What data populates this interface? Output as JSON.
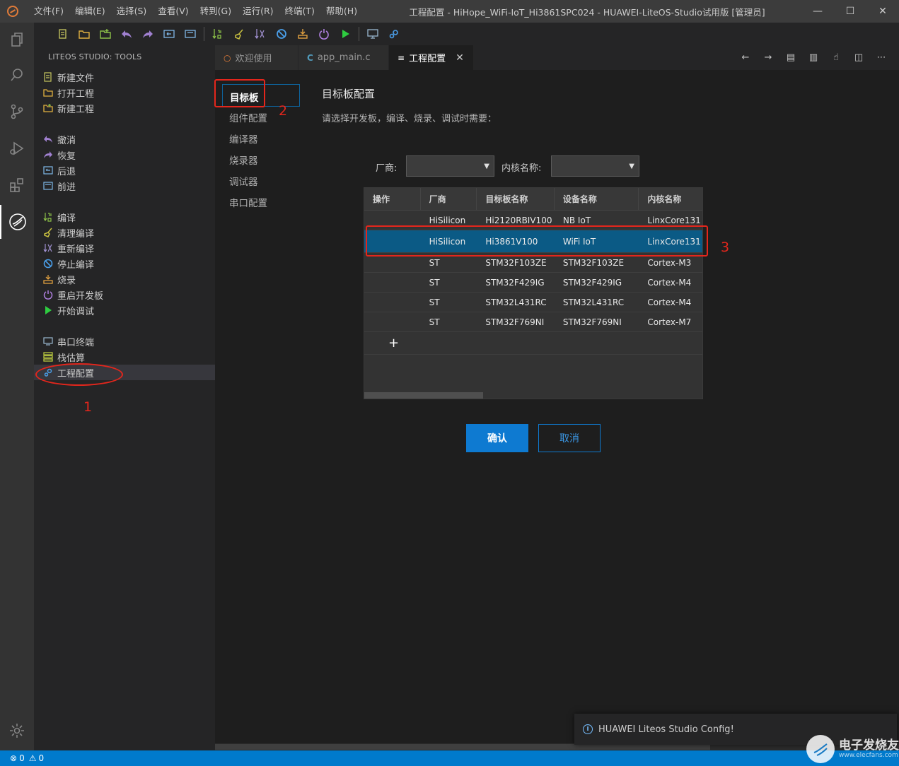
{
  "menu": [
    "文件(F)",
    "编辑(E)",
    "选择(S)",
    "查看(V)",
    "转到(G)",
    "运行(R)",
    "终端(T)",
    "帮助(H)"
  ],
  "window_title": "工程配置 - HiHope_WiFi-IoT_Hi3861SPC024 - HUAWEI-LiteOS-Studio试用版 [管理员]",
  "window_controls": {
    "minimize": "—",
    "maximize": "☐",
    "close": "✕"
  },
  "activity": [
    "files-icon",
    "search-icon",
    "source-control-icon",
    "run-debug-icon",
    "extensions-icon",
    "liteos-icon"
  ],
  "sidebar": {
    "header": "LITEOS STUDIO: TOOLS",
    "groups": [
      [
        {
          "label": "新建文件",
          "icon": "new-file-icon"
        },
        {
          "label": "打开工程",
          "icon": "open-project-icon"
        },
        {
          "label": "新建工程",
          "icon": "new-project-icon"
        }
      ],
      [
        {
          "label": "撤消",
          "icon": "undo-icon"
        },
        {
          "label": "恢复",
          "icon": "redo-icon"
        },
        {
          "label": "后退",
          "icon": "back-icon"
        },
        {
          "label": "前进",
          "icon": "forward-icon"
        }
      ],
      [
        {
          "label": "编译",
          "icon": "compile-icon"
        },
        {
          "label": "清理编译",
          "icon": "clean-icon"
        },
        {
          "label": "重新编译",
          "icon": "rebuild-icon"
        },
        {
          "label": "停止编译",
          "icon": "stop-icon"
        },
        {
          "label": "烧录",
          "icon": "burn-icon"
        },
        {
          "label": "重启开发板",
          "icon": "power-icon"
        },
        {
          "label": "开始调试",
          "icon": "play-icon"
        }
      ],
      [
        {
          "label": "串口终端",
          "icon": "serial-terminal-icon"
        },
        {
          "label": "栈估算",
          "icon": "stack-icon"
        },
        {
          "label": "工程配置",
          "icon": "config-icon"
        }
      ]
    ]
  },
  "tabs": [
    {
      "label": "欢迎使用",
      "icon": "○"
    },
    {
      "label": "app_main.c",
      "icon": "C"
    },
    {
      "label": "工程配置",
      "icon": "≡",
      "close": "✕"
    }
  ],
  "tab_actions": [
    "←",
    "→",
    "▤",
    "▥",
    "☝",
    "◫",
    "⋯"
  ],
  "config_nav": [
    "目标板",
    "组件配置",
    "编译器",
    "烧录器",
    "调试器",
    "串口配置"
  ],
  "config": {
    "title": "目标板配置",
    "desc": "请选择开发板，编译、烧录、调试时需要：",
    "vendor_label": "厂商:",
    "core_label": "内核名称:",
    "vendor_value": "",
    "core_value": "",
    "arrow": "▼"
  },
  "table": {
    "headers": [
      "操作",
      "厂商",
      "目标板名称",
      "设备名称",
      "内核名称"
    ],
    "rows": [
      [
        "",
        "HiSilicon",
        "Hi2120RBIV100",
        "NB IoT",
        "LinxCore131"
      ],
      [
        "",
        "HiSilicon",
        "Hi3861V100",
        "WiFi IoT",
        "LinxCore131"
      ],
      [
        "",
        "ST",
        "STM32F103ZE",
        "STM32F103ZE",
        "Cortex-M3"
      ],
      [
        "",
        "ST",
        "STM32F429IG",
        "STM32F429IG",
        "Cortex-M4"
      ],
      [
        "",
        "ST",
        "STM32L431RC",
        "STM32L431RC",
        "Cortex-M4"
      ],
      [
        "",
        "ST",
        "STM32F769NI",
        "STM32F769NI",
        "Cortex-M7"
      ]
    ],
    "selected_row": 1,
    "add": "+"
  },
  "buttons": {
    "confirm": "确认",
    "cancel": "取消"
  },
  "annotations": [
    "1",
    "2",
    "3"
  ],
  "status": {
    "errors": "0",
    "warnings": "0"
  },
  "toast": "HUAWEI Liteos Studio Config!",
  "watermark": {
    "title": "电子发烧友",
    "sub": "www.elecfans.com"
  },
  "colors": {
    "accent": "#007acc",
    "annotation": "#e4261c",
    "selected_row": "#0b5a85"
  }
}
